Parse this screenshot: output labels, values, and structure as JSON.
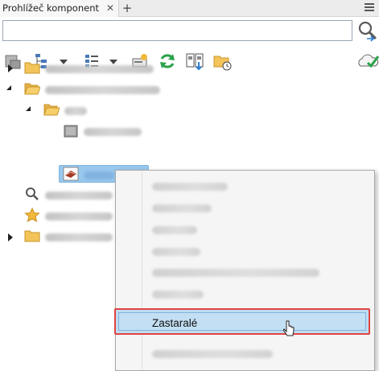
{
  "panel": {
    "tab_title": "Prohlížeč komponent",
    "tab_close": "✕",
    "tab_add": "+"
  },
  "search": {
    "value": "",
    "placeholder": ""
  },
  "toolbar": {
    "icons": [
      "save-icon",
      "tree-view-icon",
      "list-view-icon",
      "properties-icon",
      "refresh-icon",
      "compare-icon",
      "folder-clock-icon",
      "cloud-check-icon"
    ]
  },
  "context_menu": {
    "highlighted_label": "Zastaralé"
  },
  "colors": {
    "selection": "#99c8ee",
    "menu_highlight": "#c3dff3",
    "callout_red": "#e04444",
    "folder": "#f2c45a"
  }
}
